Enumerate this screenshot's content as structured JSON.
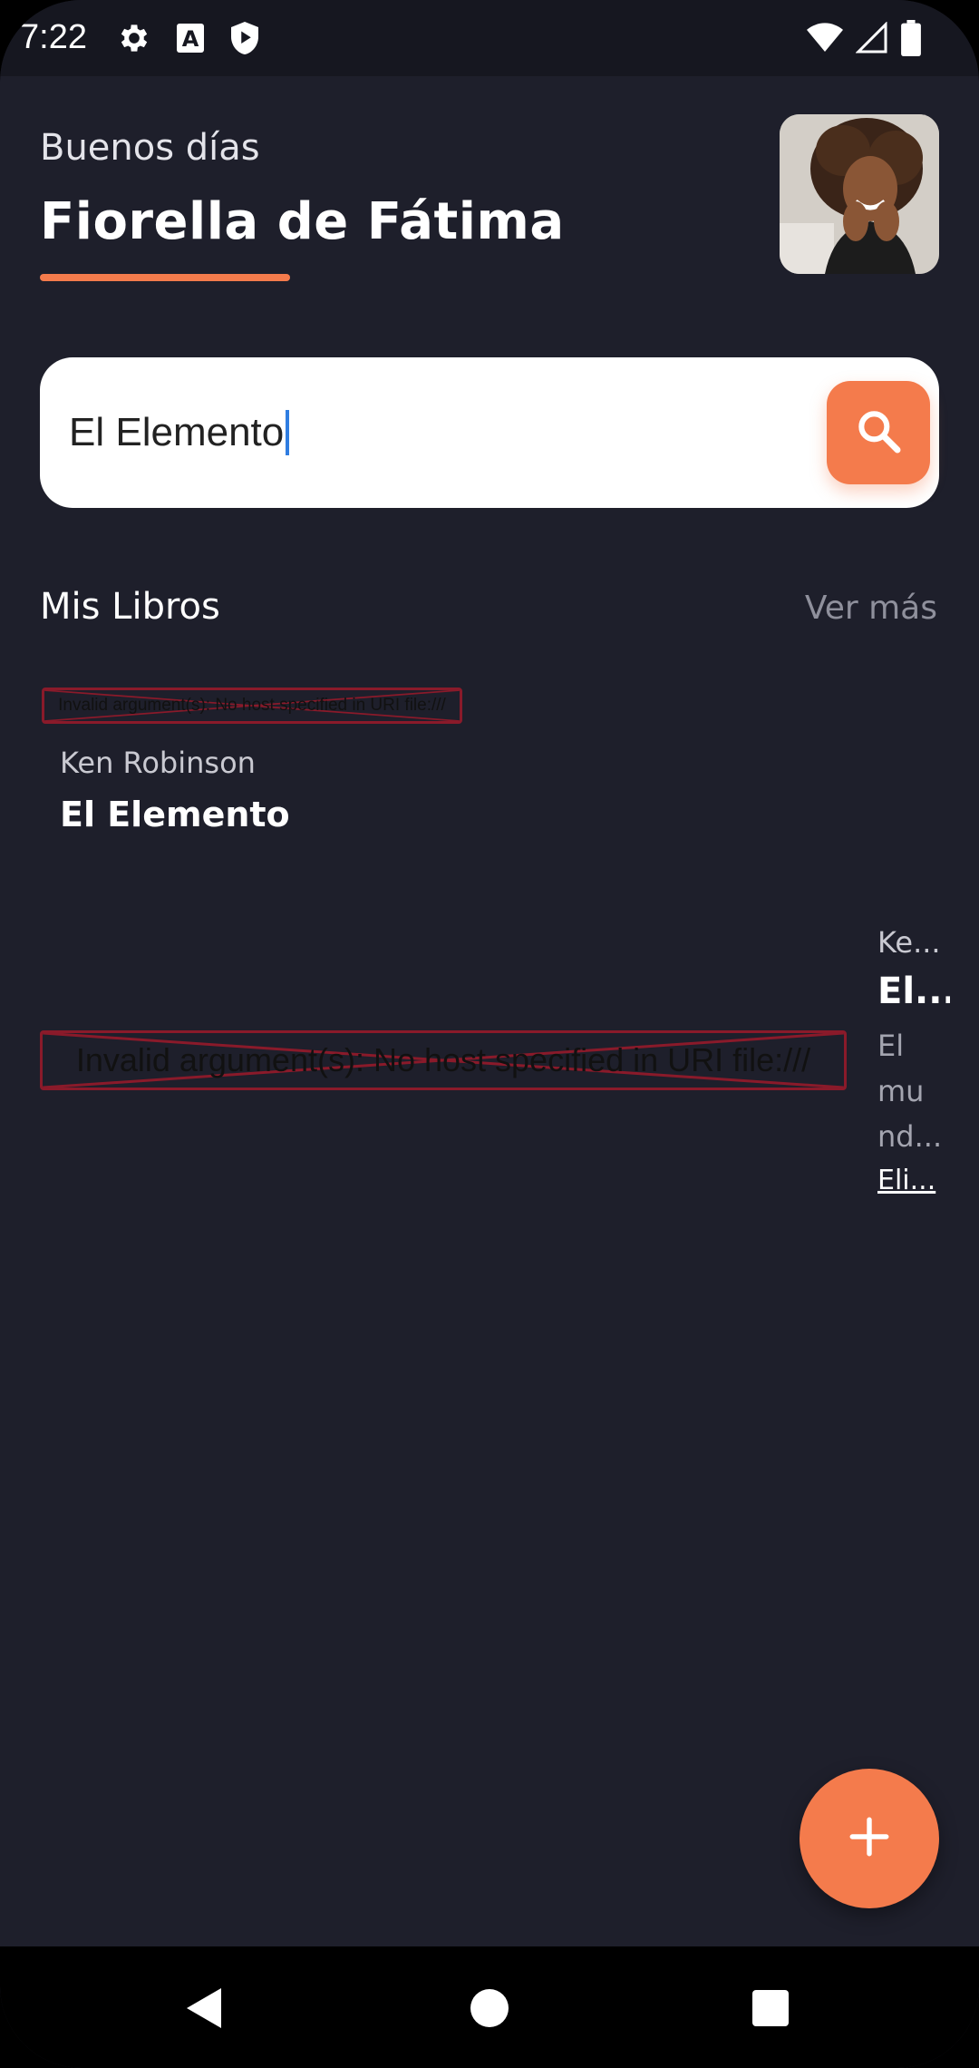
{
  "status_bar": {
    "time": "7:22",
    "left_icons": [
      "settings-icon",
      "font-a-icon",
      "shield-play-icon"
    ],
    "right_icons": [
      "wifi-icon",
      "cell-signal-icon",
      "battery-icon"
    ]
  },
  "header": {
    "greeting": "Buenos días",
    "user_name": "Fiorella de Fátima",
    "accent_color": "#f47b4c"
  },
  "search": {
    "value": "El Elemento",
    "button_icon": "search-icon"
  },
  "section": {
    "title": "Mis Libros",
    "see_more": "Ver más"
  },
  "books": [
    {
      "image_error": "Invalid argument(s): No host specified in URI file:///",
      "author": "Ken Robinson",
      "title": "El Elemento"
    }
  ],
  "detail_card": {
    "image_error": "Invalid argument(s): No host specified in URI file:///",
    "author": "Ke...",
    "title": "El...",
    "description_lines": [
      "El",
      "mu",
      "nd..."
    ],
    "link": "Eli..."
  },
  "fab": {
    "icon": "plus-icon"
  },
  "nav_bar": {
    "icons": [
      "back-icon",
      "home-icon",
      "recents-icon"
    ]
  },
  "colors": {
    "background": "#1e1f2b",
    "status_bar": "#161720",
    "accent": "#f47b4c",
    "muted_text": "#8f909c"
  }
}
